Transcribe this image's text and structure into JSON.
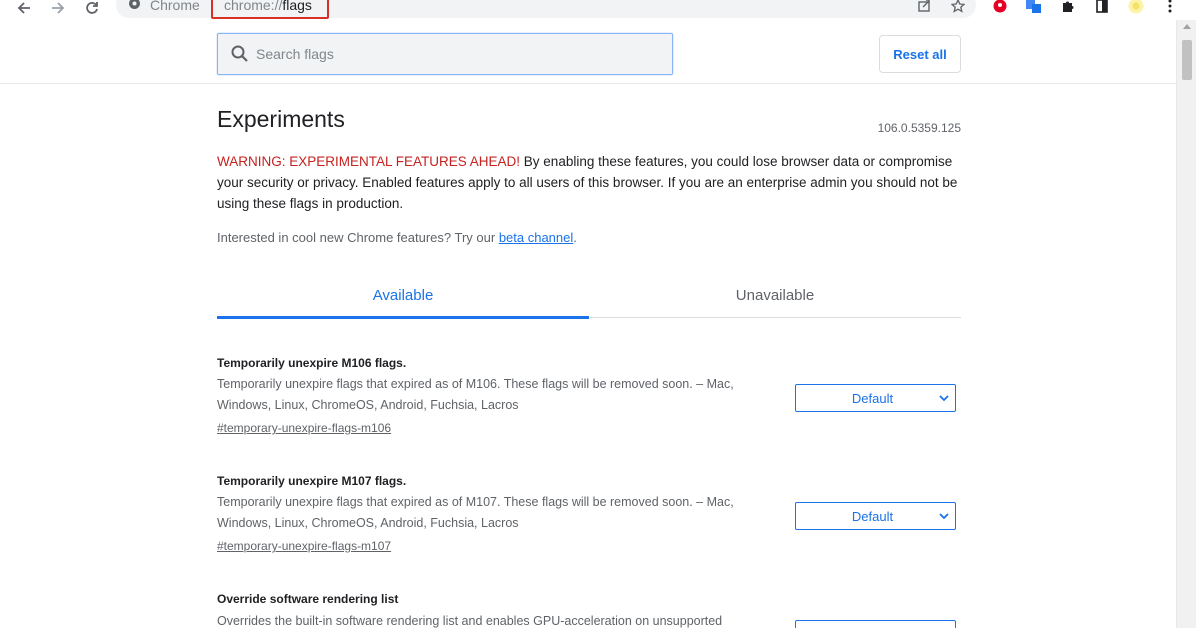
{
  "browser": {
    "nav_back_icon": "arrow-left-icon",
    "nav_forward_icon": "arrow-right-icon",
    "reload_icon": "reload-icon",
    "scheme_label": "Chrome",
    "url_scheme": "chrome://",
    "url_host": "flags"
  },
  "header": {
    "search_placeholder": "Search flags",
    "reset_label": "Reset all"
  },
  "page": {
    "title": "Experiments",
    "version": "106.0.5359.125",
    "warning_red": "WARNING: EXPERIMENTAL FEATURES AHEAD!",
    "warning_rest": " By enabling these features, you could lose browser data or compromise your security or privacy. Enabled features apply to all users of this browser. If you are an enterprise admin you should not be using these flags in production.",
    "interest_text": "Interested in cool new Chrome features? Try our ",
    "interest_link": "beta channel",
    "interest_end": "."
  },
  "tabs": [
    {
      "label": "Available",
      "active": true
    },
    {
      "label": "Unavailable",
      "active": false
    }
  ],
  "flags": [
    {
      "title": "Temporarily unexpire M106 flags.",
      "description": "Temporarily unexpire flags that expired as of M106. These flags will be removed soon. – Mac, Windows, Linux, ChromeOS, Android, Fuchsia, Lacros",
      "link": "#temporary-unexpire-flags-m106",
      "value": "Default"
    },
    {
      "title": "Temporarily unexpire M107 flags.",
      "description": "Temporarily unexpire flags that expired as of M107. These flags will be removed soon. – Mac, Windows, Linux, ChromeOS, Android, Fuchsia, Lacros",
      "link": "#temporary-unexpire-flags-m107",
      "value": "Default"
    },
    {
      "title": "Override software rendering list",
      "description": "Overrides the built-in software rendering list and enables GPU-acceleration on unsupported",
      "link": "",
      "value": ""
    }
  ],
  "colors": {
    "accent": "#1a73e8",
    "warning": "#c5221f",
    "highlight_box": "#d93025"
  }
}
